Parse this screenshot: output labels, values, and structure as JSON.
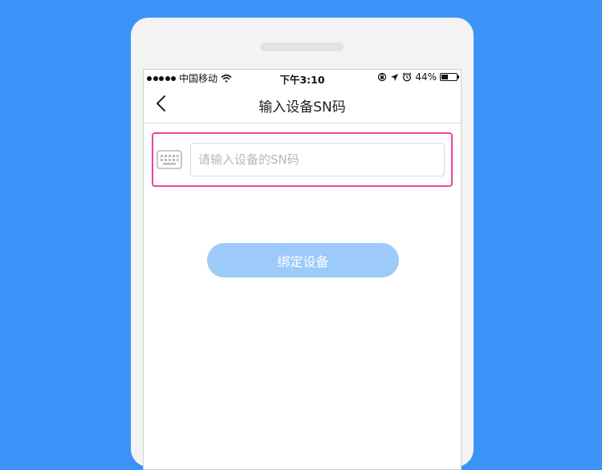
{
  "status_bar": {
    "carrier": "中国移动",
    "time": "下午3:10",
    "battery": "44%",
    "battery_level": 0.44
  },
  "nav": {
    "title": "输入设备SN码"
  },
  "sn_field": {
    "placeholder": "请输入设备的SN码",
    "value": ""
  },
  "bind_button": {
    "label": "绑定设备"
  },
  "colors": {
    "background": "#3b93f7",
    "highlight_border": "#e8489a",
    "button_bg": "#9ccbf9"
  },
  "icons": [
    "chevron-left-icon",
    "keyboard-icon",
    "wifi-icon",
    "orientation-lock-icon",
    "location-icon",
    "alarm-icon",
    "battery-icon"
  ]
}
